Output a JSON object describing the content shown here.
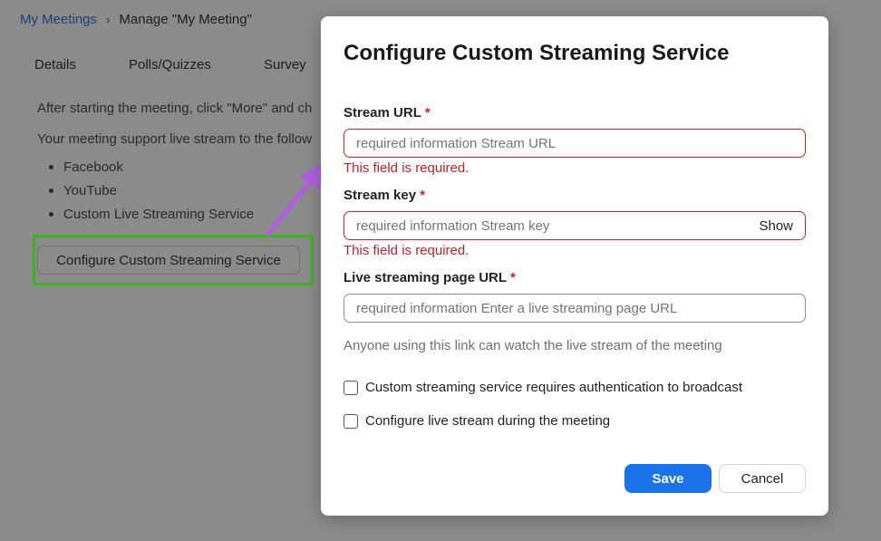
{
  "breadcrumb": {
    "link": "My Meetings",
    "separator": "›",
    "current": "Manage \"My Meeting\""
  },
  "tabs": [
    "Details",
    "Polls/Quizzes",
    "Survey"
  ],
  "background": {
    "line1": "After starting the meeting, click \"More\" and ch",
    "line2": "Your meeting support live stream to the follow",
    "services": [
      "Facebook",
      "YouTube",
      "Custom Live Streaming Service"
    ],
    "config_button": "Configure Custom Streaming Service"
  },
  "modal": {
    "title": "Configure Custom Streaming Service",
    "required_mark": "*",
    "stream_url": {
      "label": "Stream URL",
      "placeholder": "required information Stream URL",
      "error": "This field is required."
    },
    "stream_key": {
      "label": "Stream key",
      "placeholder": "required information Stream key",
      "show_label": "Show",
      "error": "This field is required."
    },
    "page_url": {
      "label": "Live streaming page URL",
      "placeholder": "required information Enter a live streaming page URL",
      "hint": "Anyone using this link can watch the live stream of the meeting"
    },
    "checkboxes": [
      "Custom streaming service requires authentication to broadcast",
      "Configure live stream during the meeting"
    ],
    "save_label": "Save",
    "cancel_label": "Cancel"
  },
  "colors": {
    "accent": "#1a73e8",
    "error": "#c0262d",
    "highlight": "#3fb223",
    "annotation_arrow": "#b05fe0"
  }
}
